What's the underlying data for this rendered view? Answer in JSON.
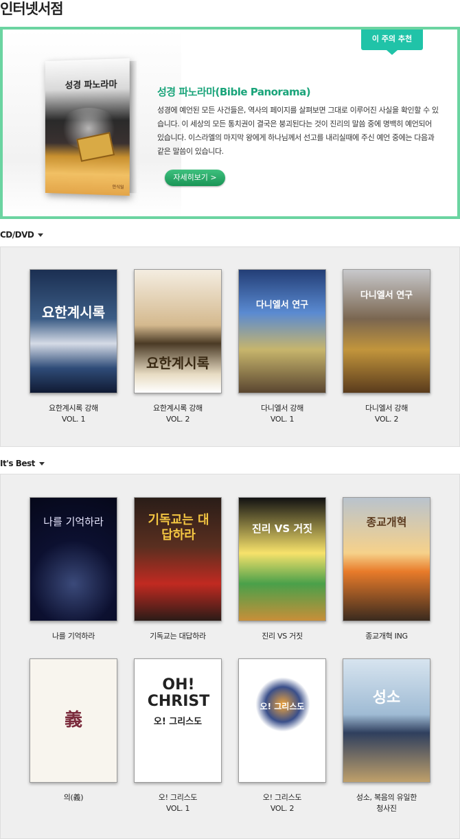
{
  "page_title": "인터넷서점",
  "featured": {
    "badge": "이 주의 추천",
    "cover_title": "성경 파노라마",
    "cover_publisher": "안식일",
    "title": "성경 파노라마(Bible Panorama)",
    "description": "성경에 예언된 모든 사건들은, 역사의 페이지를 살펴보면 그대로 이루어진 사실을 확인할 수 있습니다. 이 세상의 모든 통치권이 결국은 붕괴된다는 것이 진리의 말씀 중에 명백히 예언되어 있습니다. 이스라엘의 마지막 왕에게 하나님께서 선고를 내리실때에 주신 예언 중에는 다음과 같은 말씀이 있습니다.",
    "more_label": "자세히보기 >"
  },
  "sections": {
    "cd": {
      "heading": "CD/DVD",
      "items": [
        {
          "cover_text": "요한계시록",
          "line1": "요한계시록 강해",
          "line2": "VOL. 1"
        },
        {
          "cover_text": "요한계시록",
          "line1": "요한계시록 강해",
          "line2": "VOL. 2"
        },
        {
          "cover_text": "다니엘서 연구",
          "line1": "다니엘서 강해",
          "line2": "VOL. 1"
        },
        {
          "cover_text": "다니엘서 연구",
          "line1": "다니엘서 강해",
          "line2": "VOL. 2"
        }
      ]
    },
    "best": {
      "heading": "It's Best",
      "items": [
        {
          "cover_text": "나를 기억하라",
          "line1": "나를 기억하라",
          "line2": ""
        },
        {
          "cover_text": "기독교는 대답하라",
          "line1": "기독교는 대답하라",
          "line2": ""
        },
        {
          "cover_text": "진리 VS 거짓",
          "line1": "진리 VS 거짓",
          "line2": ""
        },
        {
          "cover_text": "종교개혁",
          "line1": "종교개혁 ING",
          "line2": ""
        },
        {
          "cover_text": "義",
          "line1": "의(義)",
          "line2": ""
        },
        {
          "cover_text": "OH! CHRIST",
          "line1": "오! 그리스도",
          "line2": "VOL. 1"
        },
        {
          "cover_text": "오! 그리스도",
          "line1": "오! 그리스도",
          "line2": "VOL. 2"
        },
        {
          "cover_text": "성소",
          "line1": "성소, 복음의 유일한",
          "line2": "청사진"
        }
      ]
    }
  },
  "colors": {
    "accent": "#6bd4a1",
    "badge": "#20c3a8",
    "title_green": "#1aa47a",
    "button": "#1a9556",
    "panel_bg": "#efefef"
  }
}
